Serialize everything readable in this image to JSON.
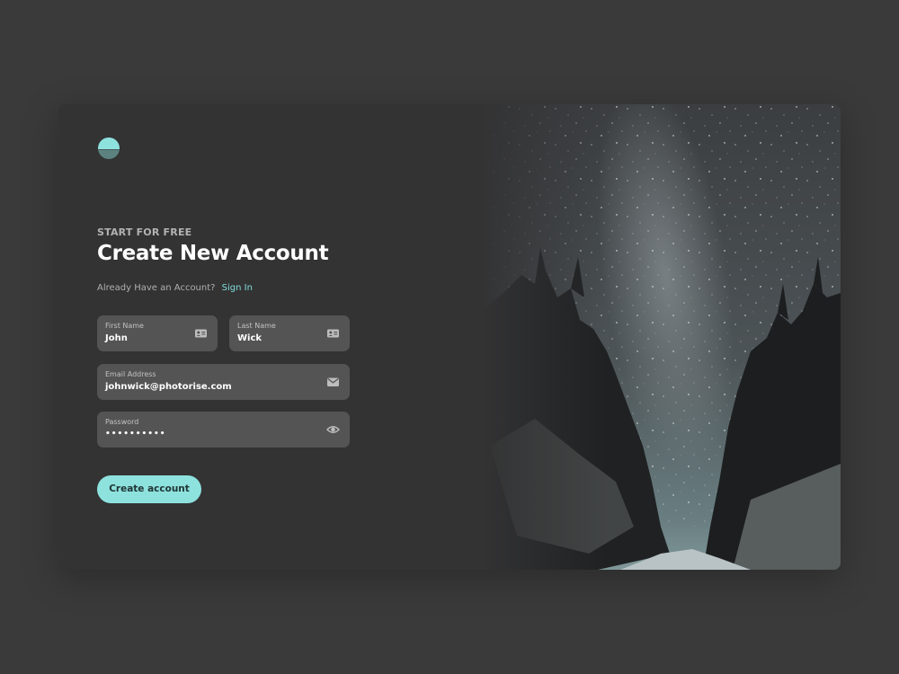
{
  "header": {
    "eyebrow": "START FOR FREE",
    "title": "Create New Account",
    "signin_prompt": "Already Have an Account?",
    "signin_link": "Sign In"
  },
  "form": {
    "first_name": {
      "label": "First Name",
      "value": "John",
      "icon": "id-card-icon"
    },
    "last_name": {
      "label": "Last Name",
      "value": "Wick",
      "icon": "id-card-icon"
    },
    "email": {
      "label": "Email Address",
      "value": "johnwick@photorise.com",
      "icon": "envelope-icon"
    },
    "password": {
      "label": "Password",
      "value": "••••••••••",
      "icon": "eye-icon"
    },
    "submit_label": "Create account"
  },
  "hero_image": {
    "subject": "snowy forest road under milky way night sky"
  },
  "colors": {
    "background": "#3a3a3b",
    "card": "#333334",
    "field": "#545455",
    "accent": "#8ee2de",
    "link": "#7fdcd8"
  }
}
